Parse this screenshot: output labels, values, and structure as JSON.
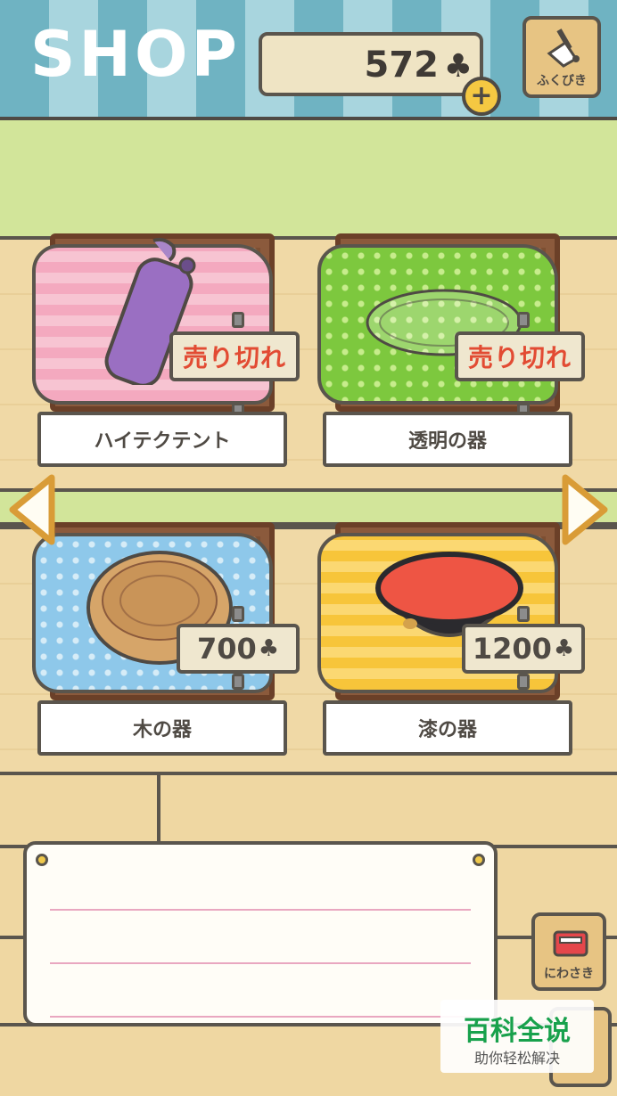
{
  "header": {
    "title": "SHOP",
    "coins": "572",
    "coin_icon": "clover-icon",
    "plus_label": "+",
    "lottery_label": "ふくびき"
  },
  "items": [
    {
      "name": "ハイテクテント",
      "status": "売り切れ",
      "cloth_color": "#f4a9bf"
    },
    {
      "name": "透明の器",
      "status": "売り切れ",
      "cloth_color": "#7dc83e"
    },
    {
      "name": "木の器",
      "price": "700",
      "cloth_color": "#8ec8ea"
    },
    {
      "name": "漆の器",
      "price": "1200",
      "cloth_color": "#f7c53a"
    }
  ],
  "mail_label": "にわさき",
  "watermark": {
    "title": "百科全说",
    "subtitle": "助你轻松解决"
  },
  "colors": {
    "awning_dark": "#6fb3c2",
    "awning_light": "#a8d5de",
    "wall": "#d2e59a",
    "wood": "#f0d9a6",
    "sold_out_text": "#e24b33"
  }
}
